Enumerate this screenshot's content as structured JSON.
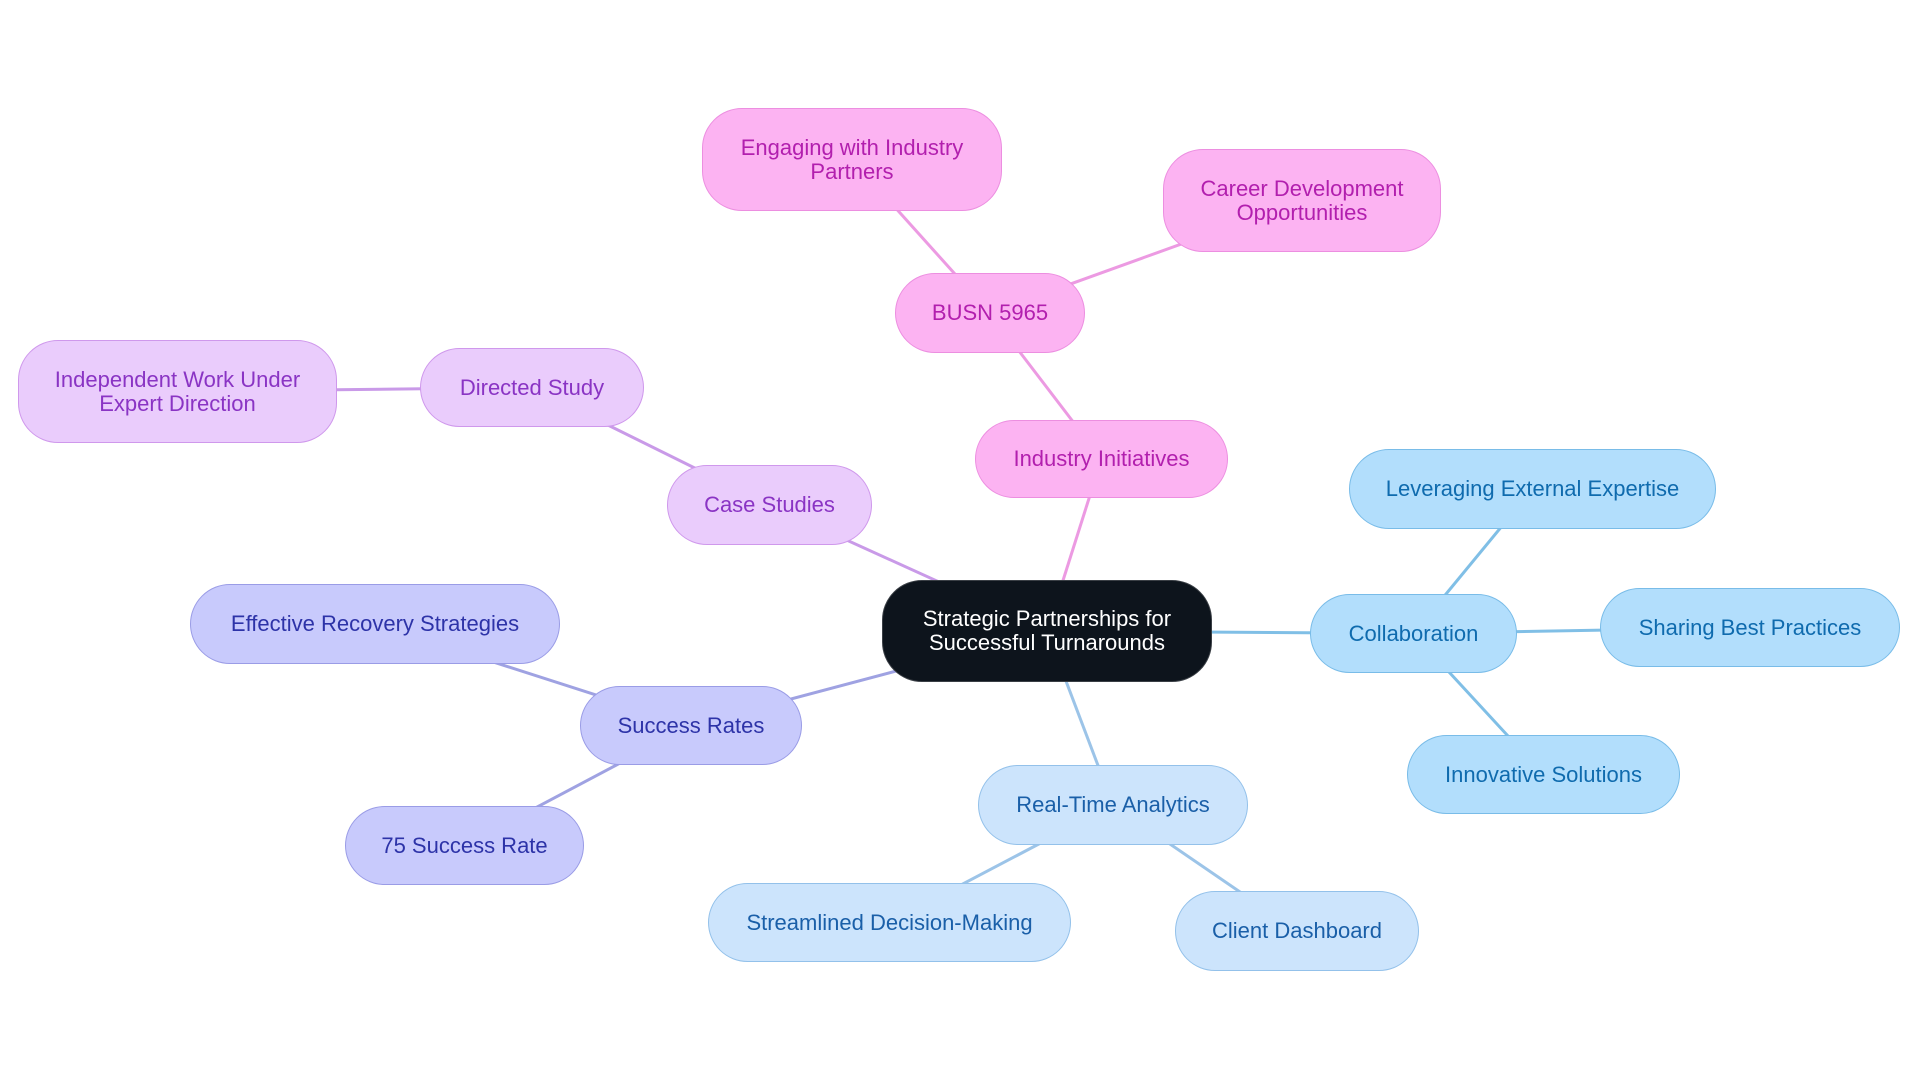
{
  "diagram": {
    "type": "mindmap",
    "root": {
      "id": "root",
      "label": "Strategic Partnerships for\nSuccessful Turnarounds"
    },
    "nodes": [
      {
        "id": "industry",
        "label": "Industry Initiatives",
        "parent": "root",
        "branch": "pink"
      },
      {
        "id": "busn",
        "label": "BUSN 5965",
        "parent": "industry",
        "branch": "pink"
      },
      {
        "id": "engaging",
        "label": "Engaging with Industry\nPartners",
        "parent": "busn",
        "branch": "pink"
      },
      {
        "id": "career",
        "label": "Career Development\nOpportunities",
        "parent": "busn",
        "branch": "pink"
      },
      {
        "id": "case",
        "label": "Case Studies",
        "parent": "root",
        "branch": "purple"
      },
      {
        "id": "directed",
        "label": "Directed Study",
        "parent": "case",
        "branch": "purple"
      },
      {
        "id": "independent",
        "label": "Independent Work Under\nExpert Direction",
        "parent": "directed",
        "branch": "purple"
      },
      {
        "id": "success",
        "label": "Success Rates",
        "parent": "root",
        "branch": "indigo"
      },
      {
        "id": "effective",
        "label": "Effective Recovery Strategies",
        "parent": "success",
        "branch": "indigo"
      },
      {
        "id": "rate75",
        "label": "75 Success Rate",
        "parent": "success",
        "branch": "indigo"
      },
      {
        "id": "collab",
        "label": "Collaboration",
        "parent": "root",
        "branch": "sky"
      },
      {
        "id": "leveraging",
        "label": "Leveraging External Expertise",
        "parent": "collab",
        "branch": "sky"
      },
      {
        "id": "sharing",
        "label": "Sharing Best Practices",
        "parent": "collab",
        "branch": "sky"
      },
      {
        "id": "innovative",
        "label": "Innovative Solutions",
        "parent": "collab",
        "branch": "sky"
      },
      {
        "id": "realtime",
        "label": "Real-Time Analytics",
        "parent": "root",
        "branch": "light"
      },
      {
        "id": "streamlined",
        "label": "Streamlined Decision-Making",
        "parent": "realtime",
        "branch": "light"
      },
      {
        "id": "client",
        "label": "Client Dashboard",
        "parent": "realtime",
        "branch": "light"
      }
    ],
    "branch_colors": {
      "pink": {
        "fill": "#fcb3f2",
        "stroke": "#ec8ee0",
        "text": "#b21fae",
        "edge": "#ec9ae2"
      },
      "purple": {
        "fill": "#eaccfc",
        "stroke": "#cf98ec",
        "text": "#8a34c4",
        "edge": "#c99ae8"
      },
      "indigo": {
        "fill": "#c8cafc",
        "stroke": "#9a9ce6",
        "text": "#2d33a8",
        "edge": "#9fa2e2"
      },
      "sky": {
        "fill": "#b2defc",
        "stroke": "#79bce8",
        "text": "#0f6bae",
        "edge": "#80bfe6"
      },
      "light": {
        "fill": "#cce4fc",
        "stroke": "#93c1ea",
        "text": "#1a5fa8",
        "edge": "#9cc4e8"
      }
    },
    "root_colors": {
      "fill": "#0d141c",
      "text": "#ffffff"
    }
  }
}
